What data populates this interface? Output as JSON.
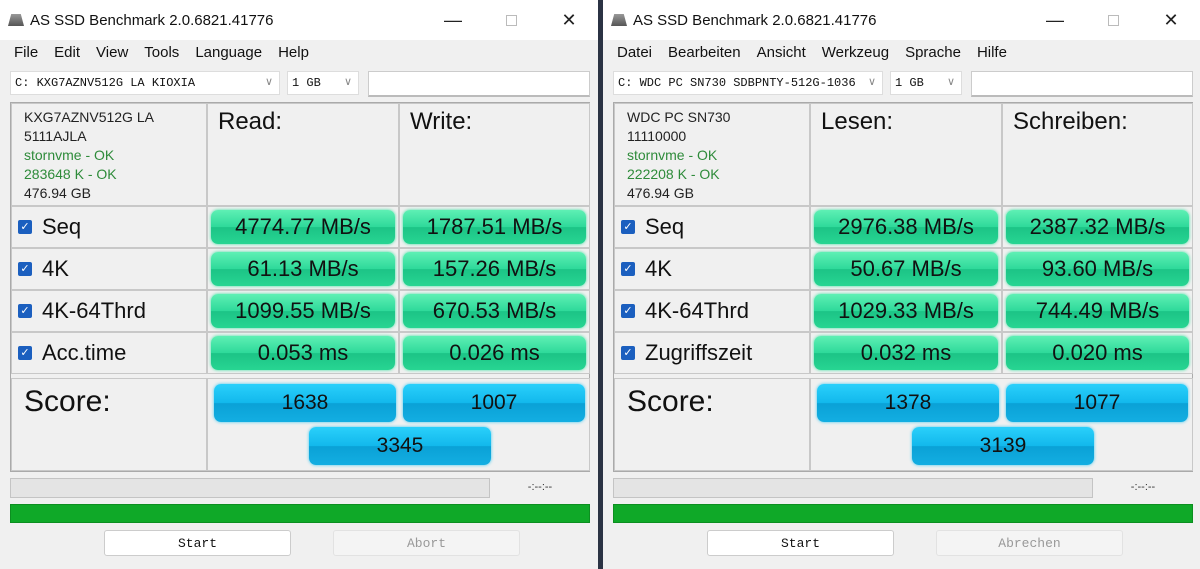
{
  "windows": [
    {
      "title": "AS SSD Benchmark 2.0.6821.41776",
      "menu": [
        "File",
        "Edit",
        "View",
        "Tools",
        "Language",
        "Help"
      ],
      "drive_select": "C: KXG7AZNV512G LA KIOXIA",
      "size_select": "1 GB",
      "drive_info": {
        "model": "KXG7AZNV512G LA",
        "firmware": "5111AJLA",
        "driver": "stornvme - OK",
        "alignment": "283648 K - OK",
        "capacity": "476.94 GB"
      },
      "read_header": "Read:",
      "write_header": "Write:",
      "rows": [
        {
          "label": "Seq",
          "checked": true,
          "read": "4774.77 MB/s",
          "write": "1787.51 MB/s"
        },
        {
          "label": "4K",
          "checked": true,
          "read": "61.13 MB/s",
          "write": "157.26 MB/s"
        },
        {
          "label": "4K-64Thrd",
          "checked": true,
          "read": "1099.55 MB/s",
          "write": "670.53 MB/s"
        },
        {
          "label": "Acc.time",
          "checked": true,
          "read": "0.053 ms",
          "write": "0.026 ms"
        }
      ],
      "score_label": "Score:",
      "score": {
        "read": "1638",
        "write": "1007",
        "total": "3345"
      },
      "elapsed": "-:--:--",
      "progress_percent": 100,
      "start_label": "Start",
      "abort_label": "Abort"
    },
    {
      "title": "AS SSD Benchmark 2.0.6821.41776",
      "menu": [
        "Datei",
        "Bearbeiten",
        "Ansicht",
        "Werkzeug",
        "Sprache",
        "Hilfe"
      ],
      "drive_select": "C: WDC PC SN730 SDBPNTY-512G-1036",
      "size_select": "1 GB",
      "drive_info": {
        "model": "WDC PC SN730",
        "firmware": "11110000",
        "driver": "stornvme - OK",
        "alignment": "222208 K - OK",
        "capacity": "476.94 GB"
      },
      "read_header": "Lesen:",
      "write_header": "Schreiben:",
      "rows": [
        {
          "label": "Seq",
          "checked": true,
          "read": "2976.38 MB/s",
          "write": "2387.32 MB/s"
        },
        {
          "label": "4K",
          "checked": true,
          "read": "50.67 MB/s",
          "write": "93.60 MB/s"
        },
        {
          "label": "4K-64Thrd",
          "checked": true,
          "read": "1029.33 MB/s",
          "write": "744.49 MB/s"
        },
        {
          "label": "Zugriffszeit",
          "checked": true,
          "read": "0.032 ms",
          "write": "0.020 ms"
        }
      ],
      "score_label": "Score:",
      "score": {
        "read": "1378",
        "write": "1077",
        "total": "3139"
      },
      "elapsed": "-:--:--",
      "progress_percent": 100,
      "start_label": "Start",
      "abort_label": "Abrechen"
    }
  ],
  "colors": {
    "result_green": "#2ed99a",
    "score_blue": "#12b8ec",
    "progress_green": "#0fa928",
    "checkbox": "#1b5fbf"
  }
}
